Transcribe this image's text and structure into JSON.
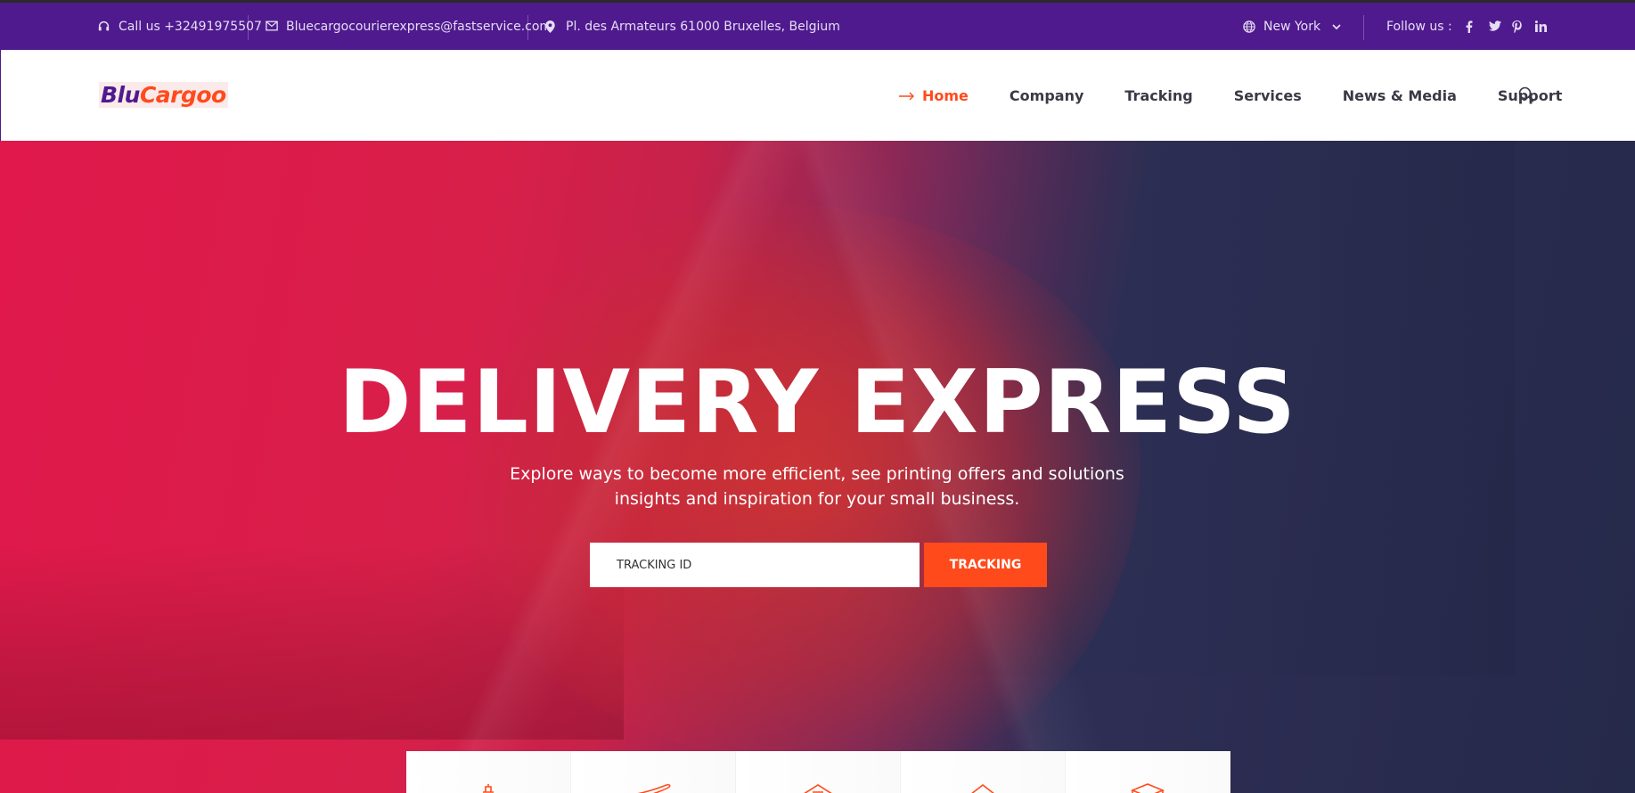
{
  "topbar": {
    "phone": "Call us +32491975507",
    "email": "Bluecargocourierexpress@fastservice.com",
    "address": "Pl. des Armateurs 61000 Bruxelles, Belgium",
    "city": "New York",
    "follow": "Follow us :",
    "social": [
      "facebook",
      "twitter",
      "pinterest",
      "linkedin"
    ]
  },
  "header": {
    "logo_part1": "Blu",
    "logo_part2": "Cargoo",
    "nav": [
      {
        "label": "Home",
        "active": true
      },
      {
        "label": "Company"
      },
      {
        "label": "Tracking"
      },
      {
        "label": "Services"
      },
      {
        "label": "News & Media"
      },
      {
        "label": "Support"
      }
    ]
  },
  "hero": {
    "title": "DELIVERY EXPRESS",
    "subtitle": "Explore ways to become more efficient, see printing offers and solutions insights and inspiration for your small business.",
    "tracking_placeholder": "TRACKING ID",
    "tracking_button": "TRACKING"
  },
  "services": {
    "icons": [
      "ship-icon",
      "plane-icon",
      "warehouse-icon",
      "house-icon",
      "box-icon"
    ]
  },
  "colors": {
    "topbar": "#4f1a8e",
    "accent": "#ff4a1c",
    "nav_text": "#3a3a46",
    "hero_red": "#e0184b",
    "hero_navy": "#25294a"
  }
}
